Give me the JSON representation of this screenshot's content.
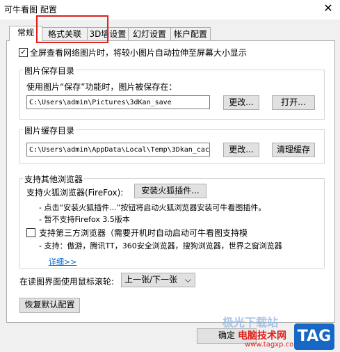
{
  "window": {
    "title": "可牛看图 配置",
    "close_label": "✕"
  },
  "tabs": [
    {
      "label": "常规",
      "active": true
    },
    {
      "label": "格式关联"
    },
    {
      "label": "3D墙设置"
    },
    {
      "label": "幻灯设置"
    },
    {
      "label": "帐户配置"
    }
  ],
  "general": {
    "fullscreen_checkbox": {
      "checked": true,
      "label": "全屏查看网络图片时，将较小图片自动拉伸至屏幕大小显示"
    },
    "save_dir": {
      "legend": "图片保存目录",
      "desc": "使用图片“保存”功能时，图片被保存在：",
      "path": "C:\\Users\\admin\\Pictures\\3dKan_save",
      "change_button": "更改...",
      "open_button": "打开..."
    },
    "cache_dir": {
      "legend": "图片缓存目录",
      "path": "C:\\Users\\admin\\AppData\\Local\\Temp\\3Dkan_cac",
      "change_button": "更改...",
      "clear_button": "清理缓存"
    },
    "browsers": {
      "legend": "支持其他浏览器",
      "firefox_label": "支持火狐浏览器(FireFox):",
      "firefox_button": "安装火狐插件...",
      "firefox_note1": "- 点击“安装火狐插件...”按钮将启动火狐浏览器安装可牛看图插件。",
      "firefox_note2": "- 暂不支持Firefox 3.5版本",
      "third_party_checkbox": {
        "checked": false,
        "label": "支持第三方浏览器（需要开机时自动启动可牛看图支持模"
      },
      "third_party_note": "- 支持：傲游，腾讯TT，360安全浏览器，搜狗浏览器，世界之窗浏览器",
      "details_link": "详细>>"
    },
    "wheel": {
      "label": "在读图界面使用鼠标滚轮:",
      "value": "上一张/下一张",
      "arrow": "⌵"
    },
    "restore_button": "恢复默认配置"
  },
  "footer": {
    "ok_button": "确定"
  },
  "watermark": {
    "line1": "极光下载站",
    "line2": "电脑技术网",
    "url": "www.tagxp.com",
    "tag": "TAG"
  }
}
